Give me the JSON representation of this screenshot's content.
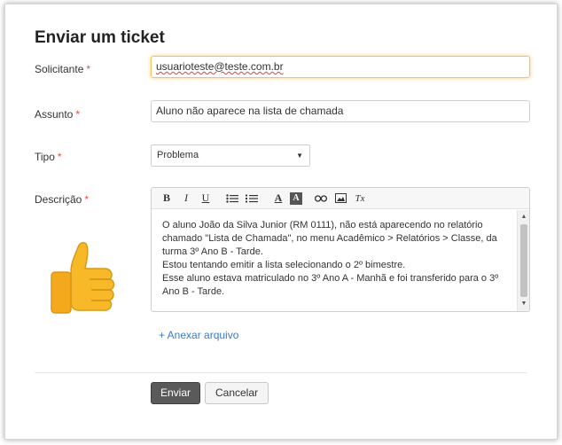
{
  "form": {
    "title": "Enviar um ticket",
    "required_mark": "*",
    "requester": {
      "label": "Solicitante",
      "value": "usuarioteste@teste.com.br"
    },
    "subject": {
      "label": "Assunto",
      "value": "Aluno não aparece na lista de chamada"
    },
    "type": {
      "label": "Tipo",
      "selected": "Problema",
      "arrow": "▼"
    },
    "description": {
      "label": "Descrição",
      "toolbar": [
        "bold-icon",
        "italic-icon",
        "underline-icon",
        "bulleted-list-icon",
        "numbered-list-icon",
        "text-color-icon",
        "background-color-icon",
        "link-icon",
        "image-icon",
        "clear-format-icon"
      ],
      "toolbar_glyphs": {
        "bold": "B",
        "italic": "I",
        "underline": "U",
        "text_color": "A",
        "background_color": "A",
        "link": "⚭",
        "clear_format": "Tx"
      },
      "text": [
        "O aluno João da Silva Junior (RM 0111), não está aparecendo no relatório chamado \"Lista de Chamada\", no menu Acadêmico > Relatórios > Classe, da turma 3º Ano B - Tarde.",
        "Estou tentando emitir a lista selecionando o 2º bimestre.",
        "Esse aluno estava matriculado no 3º Ano A - Manhã e foi transferido para o 3º Ano B - Tarde."
      ]
    },
    "attach_label": "+ Anexar arquivo",
    "submit_label": "Enviar",
    "cancel_label": "Cancelar"
  },
  "scroll": {
    "up": "▲",
    "down": "▼"
  },
  "decoration": {
    "emoji": "thumbs-up-emoji"
  },
  "colors": {
    "required": "#e34b4b",
    "link": "#3b79c9",
    "primary_button": "#5a5a5a",
    "focus": "#f0c560"
  }
}
